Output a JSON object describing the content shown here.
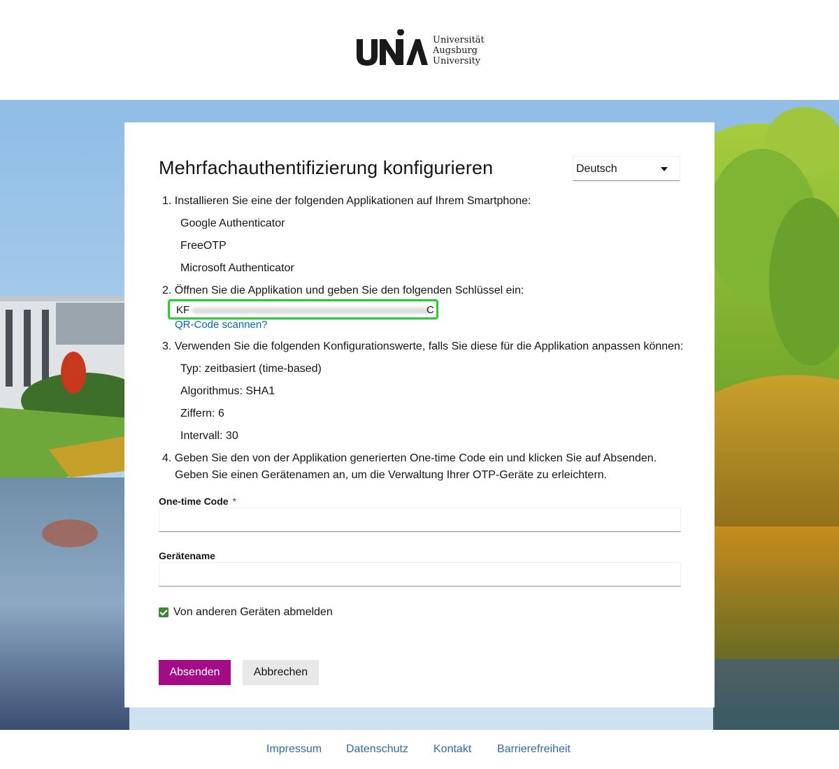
{
  "brand": {
    "logo_mark": "UNIA",
    "name_lines": [
      "Universität",
      "Augsburg",
      "University"
    ]
  },
  "page": {
    "title": "Mehrfachauthentifizierung konfigurieren"
  },
  "language": {
    "selected": "Deutsch"
  },
  "steps": {
    "step1": "1. Installieren Sie eine der folgenden Applikationen auf Ihrem Smartphone:",
    "apps": [
      "Google Authenticator",
      "FreeOTP",
      "Microsoft Authenticator"
    ],
    "step2": "2. Öffnen Sie die Applikation und geben Sie den folgenden Schlüssel ein:",
    "secret_visible_start": "KF",
    "secret_visible_end": "C",
    "qr_link": "QR-Code scannen?",
    "step3": "3. Verwenden Sie die folgenden Konfigurationswerte, falls Sie diese für die Applikation anpassen können:",
    "config": [
      "Typ: zeitbasiert (time-based)",
      "Algorithmus: SHA1",
      "Ziffern: 6",
      "Intervall: 30"
    ],
    "step4_line1": "4. Geben Sie den von der Applikation generierten One-time Code ein und klicken Sie auf Absenden.",
    "step4_line2": "Geben Sie einen Gerätenamen an, um die Verwaltung Ihrer OTP-Geräte zu erleichtern."
  },
  "form": {
    "otp_label": "One-time Code",
    "required_marker": "*",
    "otp_value": "",
    "device_label": "Gerätename",
    "device_value": "",
    "logout_label": "Von anderen Geräten abmelden",
    "logout_checked": true,
    "submit": "Absenden",
    "cancel": "Abbrechen"
  },
  "footer": {
    "links": [
      "Impressum",
      "Datenschutz",
      "Kontakt",
      "Barrierefreiheit"
    ]
  },
  "colors": {
    "primary": "#a30c84",
    "link": "#0066cc",
    "highlight": "#1ed62a",
    "checkbox": "#3e8635"
  }
}
